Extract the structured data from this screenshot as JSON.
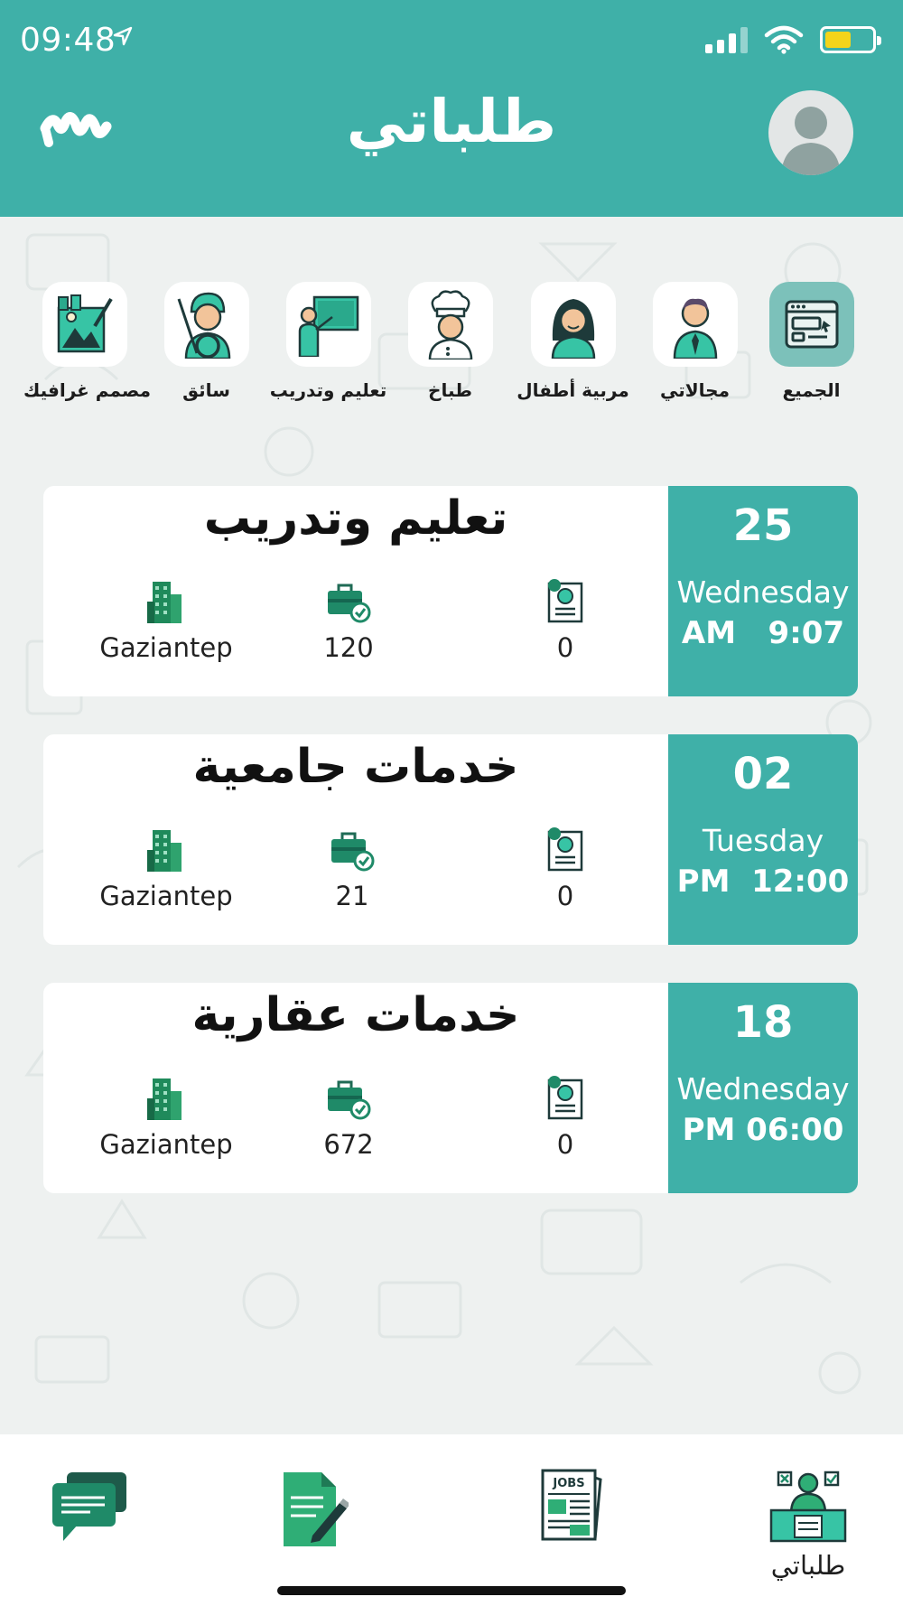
{
  "status_bar": {
    "time": "09:48"
  },
  "header": {
    "title": "طلباتي"
  },
  "categories": [
    {
      "label": "الجميع",
      "icon": "all-window-icon",
      "active": true
    },
    {
      "label": "مجالاتي",
      "icon": "businessman-icon",
      "active": false
    },
    {
      "label": "مربية أطفال",
      "icon": "nanny-icon",
      "active": false
    },
    {
      "label": "طباخ",
      "icon": "chef-icon",
      "active": false
    },
    {
      "label": "تعليم وتدريب",
      "icon": "teacher-board-icon",
      "active": false
    },
    {
      "label": "سائق",
      "icon": "driver-icon",
      "active": false
    },
    {
      "label": "مصمم غرافيك",
      "icon": "graphic-designer-icon",
      "active": false
    }
  ],
  "requests": [
    {
      "title": "تعليم وتدريب",
      "day": "25",
      "weekday": "Wednesday",
      "time": "AM   9:07",
      "city": "Gaziantep",
      "jobs": "120",
      "applicants": "0"
    },
    {
      "title": "خدمات جامعية",
      "day": "02",
      "weekday": "Tuesday",
      "time": "PM  12:00",
      "city": "Gaziantep",
      "jobs": "21",
      "applicants": "0"
    },
    {
      "title": "خدمات عقارية",
      "day": "18",
      "weekday": "Wednesday",
      "time": "PM 06:00",
      "city": "Gaziantep",
      "jobs": "672",
      "applicants": "0"
    }
  ],
  "bottom_nav": {
    "my_requests_label": "طلباتي",
    "jobs_icon_text": "JOBS"
  },
  "colors": {
    "primary": "#3fb0a8",
    "active_tile": "#7cc1ba",
    "icon_green": "#1a8a68"
  }
}
